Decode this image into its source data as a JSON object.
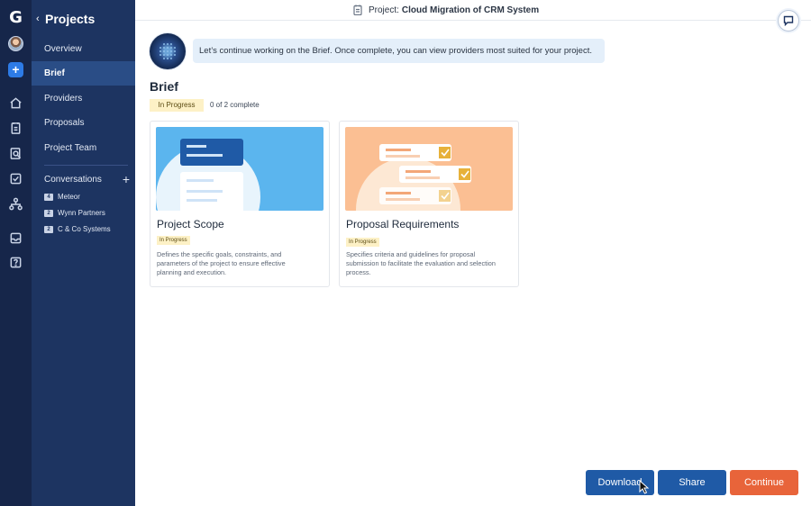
{
  "brand": {
    "logo_letter": "G"
  },
  "rail": {
    "icons": [
      "home-icon",
      "document-icon",
      "search-document-icon",
      "checkbox-icon",
      "org-chart-icon",
      "inbox-icon",
      "help-icon"
    ]
  },
  "sidebar": {
    "back_label": "Projects",
    "items": [
      {
        "label": "Overview",
        "active": false
      },
      {
        "label": "Brief",
        "active": true
      },
      {
        "label": "Providers",
        "active": false
      },
      {
        "label": "Proposals",
        "active": false
      },
      {
        "label": "Project Team",
        "active": false
      }
    ],
    "conversations": {
      "label": "Conversations",
      "items": [
        {
          "count": "4",
          "name": "Meteor"
        },
        {
          "count": "2",
          "name": "Wynn Partners"
        },
        {
          "count": "2",
          "name": "C & Co Systems"
        }
      ]
    }
  },
  "header": {
    "prefix": "Project:",
    "project_name": "Cloud Migration of CRM System"
  },
  "assistant": {
    "message": "Let’s continue working on the Brief. Once complete, you can view providers most suited for your project."
  },
  "brief": {
    "title": "Brief",
    "status": "In Progress",
    "progress": "0 of 2 complete",
    "cards": [
      {
        "title": "Project Scope",
        "status": "In Progress",
        "description": "Defines the specific goals, constraints, and parameters of the project to ensure effective planning and execution."
      },
      {
        "title": "Proposal Requirements",
        "status": "In Progress",
        "description": "Specifies criteria and guidelines for proposal submission to facilitate the evaluation and selection process."
      }
    ]
  },
  "actions": {
    "download": "Download",
    "share": "Share",
    "continue": "Continue"
  },
  "colors": {
    "rail": "#16264a",
    "sidebar": "#1d3461",
    "active_item": "#2a4d86",
    "primary": "#1f5aa6",
    "accent": "#e8643a",
    "badge": "#fdf1c6"
  }
}
